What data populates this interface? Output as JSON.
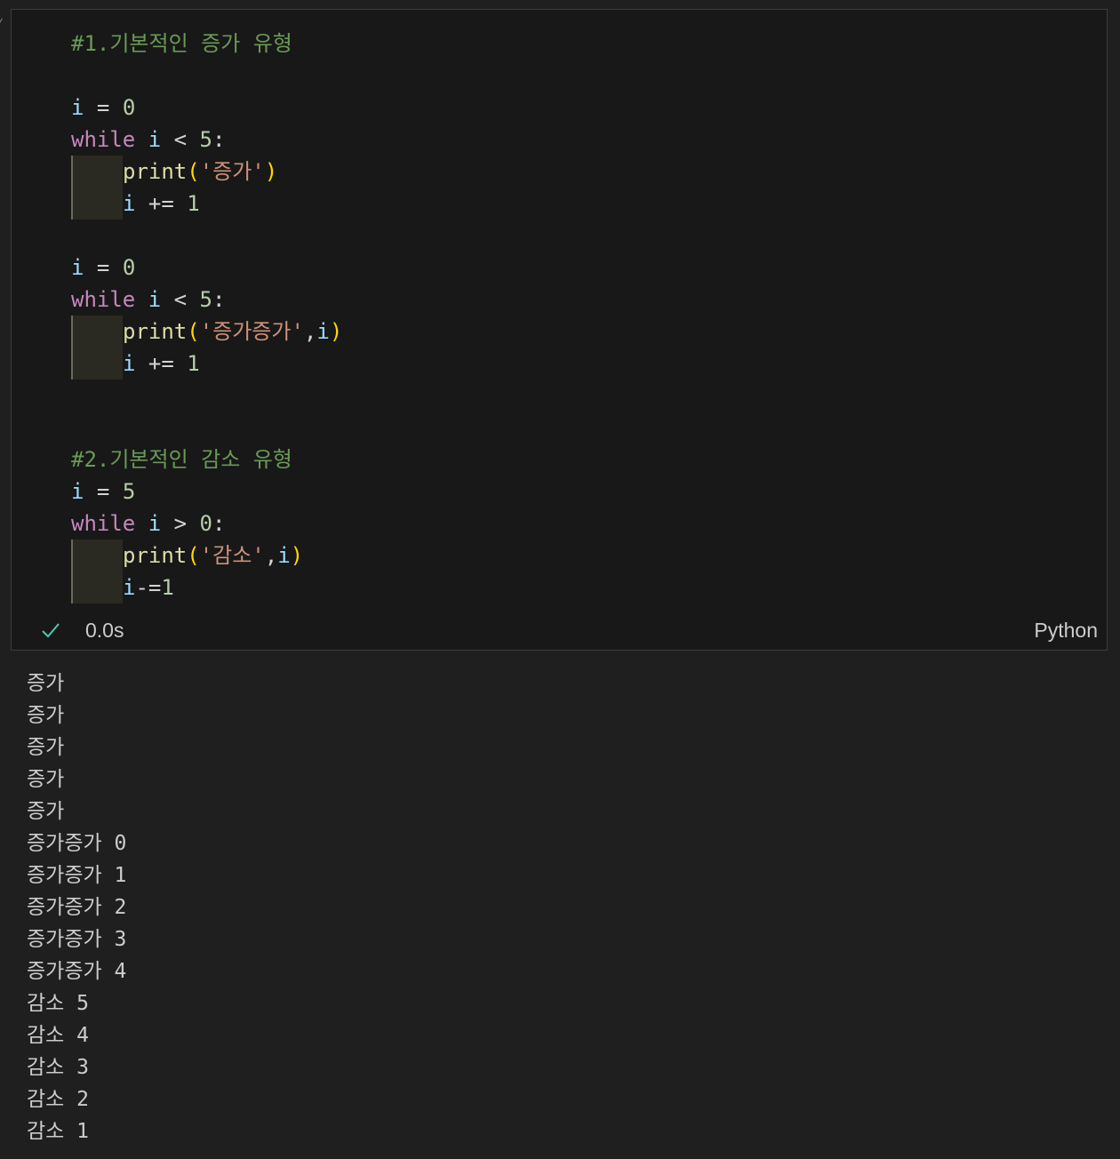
{
  "cell": {
    "code_lines": [
      {
        "indent": false,
        "tokens": [
          {
            "t": "#1.기본적인 증가 유형",
            "c": "comment"
          }
        ]
      },
      {
        "indent": false,
        "tokens": []
      },
      {
        "indent": false,
        "tokens": [
          {
            "t": "i",
            "c": "var"
          },
          {
            "t": " = ",
            "c": "op"
          },
          {
            "t": "0",
            "c": "num"
          }
        ]
      },
      {
        "indent": false,
        "tokens": [
          {
            "t": "while",
            "c": "kw"
          },
          {
            "t": " ",
            "c": "op"
          },
          {
            "t": "i",
            "c": "var"
          },
          {
            "t": " < ",
            "c": "op"
          },
          {
            "t": "5",
            "c": "num"
          },
          {
            "t": ":",
            "c": "op"
          }
        ]
      },
      {
        "indent": true,
        "tokens": [
          {
            "t": "print",
            "c": "fn"
          },
          {
            "t": "(",
            "c": "paren"
          },
          {
            "t": "'증가'",
            "c": "str"
          },
          {
            "t": ")",
            "c": "paren"
          }
        ]
      },
      {
        "indent": true,
        "tokens": [
          {
            "t": "i",
            "c": "var"
          },
          {
            "t": " += ",
            "c": "op"
          },
          {
            "t": "1",
            "c": "num"
          }
        ]
      },
      {
        "indent": false,
        "tokens": []
      },
      {
        "indent": false,
        "tokens": [
          {
            "t": "i",
            "c": "var"
          },
          {
            "t": " = ",
            "c": "op"
          },
          {
            "t": "0",
            "c": "num"
          }
        ]
      },
      {
        "indent": false,
        "tokens": [
          {
            "t": "while",
            "c": "kw"
          },
          {
            "t": " ",
            "c": "op"
          },
          {
            "t": "i",
            "c": "var"
          },
          {
            "t": " < ",
            "c": "op"
          },
          {
            "t": "5",
            "c": "num"
          },
          {
            "t": ":",
            "c": "op"
          }
        ]
      },
      {
        "indent": true,
        "tokens": [
          {
            "t": "print",
            "c": "fn"
          },
          {
            "t": "(",
            "c": "paren"
          },
          {
            "t": "'증가증가'",
            "c": "str"
          },
          {
            "t": ",",
            "c": "op"
          },
          {
            "t": "i",
            "c": "var"
          },
          {
            "t": ")",
            "c": "paren"
          }
        ]
      },
      {
        "indent": true,
        "tokens": [
          {
            "t": "i",
            "c": "var"
          },
          {
            "t": " += ",
            "c": "op"
          },
          {
            "t": "1",
            "c": "num"
          }
        ]
      },
      {
        "indent": false,
        "tokens": []
      },
      {
        "indent": false,
        "tokens": []
      },
      {
        "indent": false,
        "tokens": [
          {
            "t": "#2.기본적인 감소 유형",
            "c": "comment"
          }
        ]
      },
      {
        "indent": false,
        "tokens": [
          {
            "t": "i",
            "c": "var"
          },
          {
            "t": " = ",
            "c": "op"
          },
          {
            "t": "5",
            "c": "num"
          }
        ]
      },
      {
        "indent": false,
        "tokens": [
          {
            "t": "while",
            "c": "kw"
          },
          {
            "t": " ",
            "c": "op"
          },
          {
            "t": "i",
            "c": "var"
          },
          {
            "t": " > ",
            "c": "op"
          },
          {
            "t": "0",
            "c": "num"
          },
          {
            "t": ":",
            "c": "op"
          }
        ]
      },
      {
        "indent": true,
        "tokens": [
          {
            "t": "print",
            "c": "fn"
          },
          {
            "t": "(",
            "c": "paren"
          },
          {
            "t": "'감소'",
            "c": "str"
          },
          {
            "t": ",",
            "c": "op"
          },
          {
            "t": "i",
            "c": "var"
          },
          {
            "t": ")",
            "c": "paren"
          }
        ]
      },
      {
        "indent": true,
        "tokens": [
          {
            "t": "i",
            "c": "var"
          },
          {
            "t": "-=",
            "c": "op"
          },
          {
            "t": "1",
            "c": "num"
          }
        ]
      }
    ],
    "status": {
      "check_icon": "check-icon",
      "time": "0.0s",
      "language": "Python"
    }
  },
  "output_lines": [
    "증가",
    "증가",
    "증가",
    "증가",
    "증가",
    "증가증가 0",
    "증가증가 1",
    "증가증가 2",
    "증가증가 3",
    "증가증가 4",
    "감소 5",
    "감소 4",
    "감소 3",
    "감소 2",
    "감소 1"
  ],
  "colors": {
    "comment": "#6a9955",
    "variable": "#9cdcfe",
    "keyword": "#c586c0",
    "number": "#b5cea8",
    "function": "#dcdcaa",
    "string": "#ce9178",
    "bracket": "#ffd700",
    "success": "#4ec9b0"
  }
}
